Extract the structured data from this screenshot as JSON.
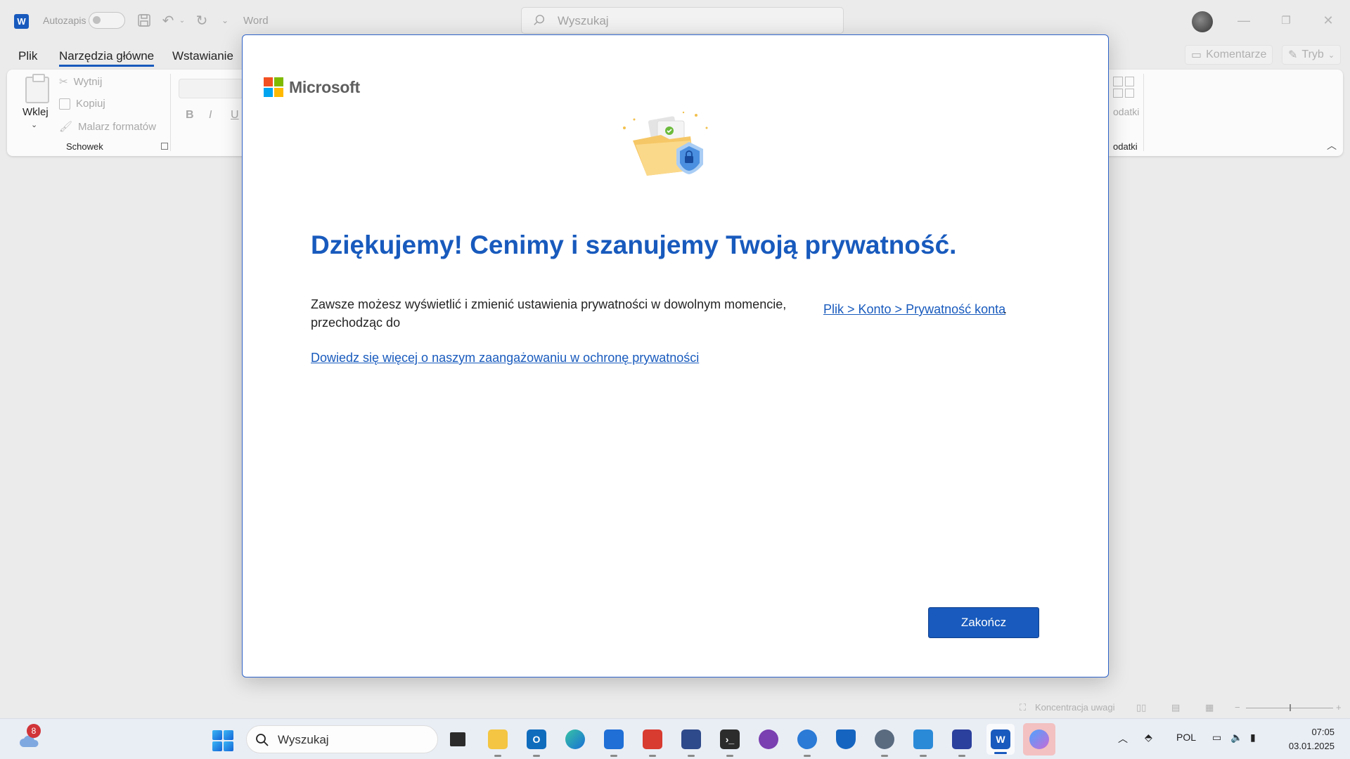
{
  "titlebar": {
    "autosave_label": "Autozapis",
    "app_name": "Word",
    "search_placeholder": "Wyszukaj"
  },
  "ribbon_tabs": [
    "Plik",
    "Narzędzia główne",
    "Wstawianie"
  ],
  "ribbon_right": {
    "comments_label": "Komentarze",
    "mode_label": "Tryb"
  },
  "clipboard": {
    "paste_label": "Wklej",
    "cut_label": "Wytnij",
    "copy_label": "Kopiuj",
    "painter_label": "Malarz formatów",
    "group_label": "Schowek"
  },
  "format": {
    "bold": "B",
    "italic": "I",
    "underline": "U"
  },
  "addins": {
    "button_label": "odatki",
    "group_label": "odatki"
  },
  "statusbar": {
    "focus_label": "Koncentracja uwagi"
  },
  "dialog": {
    "brand": "Microsoft",
    "heading": "Dziękujemy! Cenimy i szanujemy Twoją prywatność.",
    "body": "Zawsze możesz wyświetlić i zmienić ustawienia prywatności w dowolnym momencie, przechodząc do",
    "path_link": "Plik > Konto > Prywatność konta",
    "path_suffix": ".",
    "learn_more_link": "Dowiedz się więcej o naszym zaangażowaniu w ochronę prywatności",
    "finish_button": "Zakończ"
  },
  "taskbar": {
    "weather_badge": "8",
    "search_placeholder": "Wyszukaj",
    "language": "POL",
    "time": "07:05",
    "date": "03.01.2025"
  },
  "colors": {
    "accent": "#185abd",
    "modal_border": "#2f63c8"
  }
}
